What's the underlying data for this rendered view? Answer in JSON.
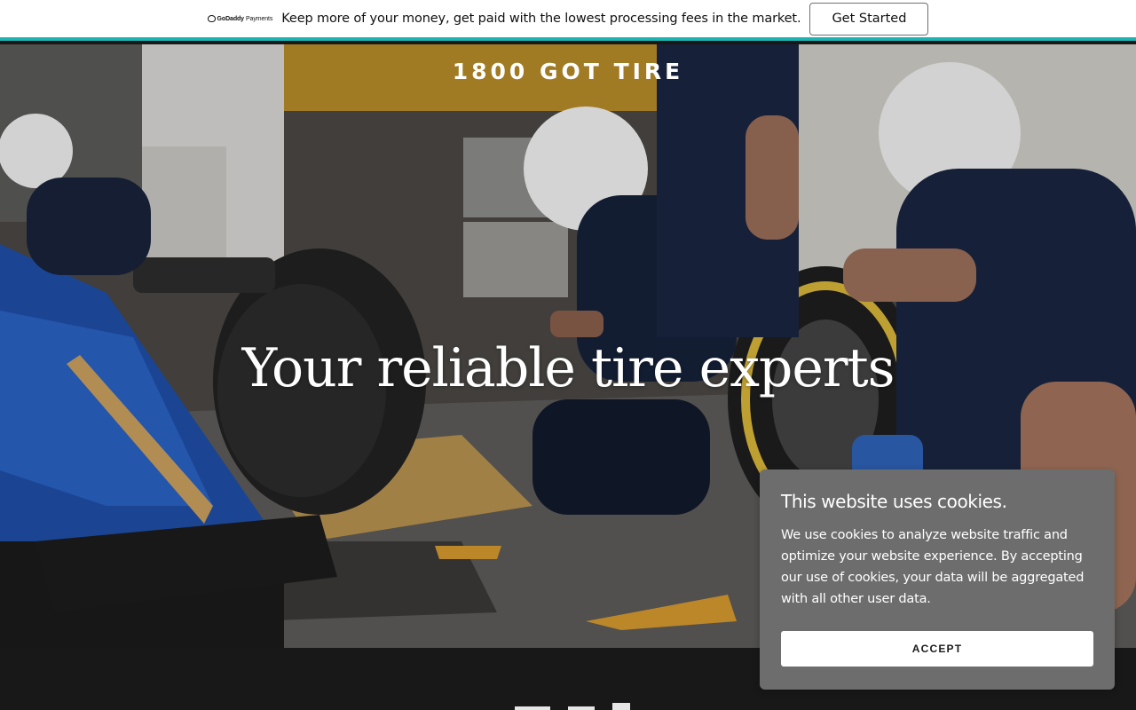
{
  "promo": {
    "logo_text": "GoDaddy Payments",
    "logo_brand": "GoDaddy",
    "logo_suffix": "Payments",
    "message": "Keep more of your money, get paid with the lowest processing fees in the market.",
    "cta": "Get Started",
    "accent_color": "#1eb3b3"
  },
  "hero": {
    "brand": "1800 GOT TIRE",
    "headline": "Your reliable tire experts",
    "image_icon": "pit-stop-photo"
  },
  "cookie": {
    "title": "This website uses cookies.",
    "body": "We use cookies to analyze website traffic and optimize your website experience. By accepting our use of cookies, your data will be aggregated with all other user data.",
    "accept": "ACCEPT"
  }
}
